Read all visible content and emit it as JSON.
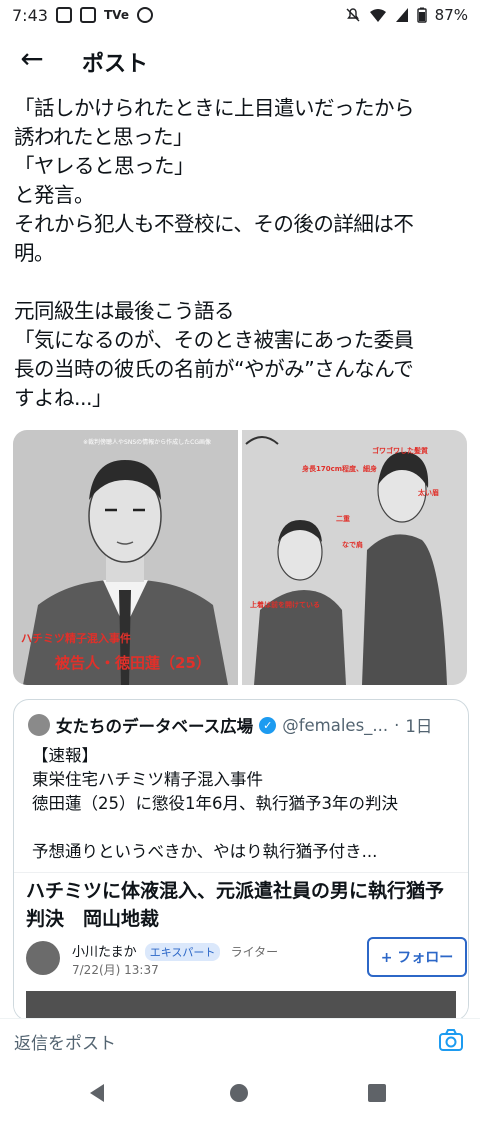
{
  "status_bar": {
    "time": "7:43",
    "left_icons": [
      "calendar-icon",
      "news-icon",
      "tver-icon",
      "lottery-icon"
    ],
    "tver_label": "TVe",
    "battery": "87%",
    "right_icons": [
      "mute-icon",
      "wifi-icon",
      "signal-icon",
      "battery-icon"
    ]
  },
  "header": {
    "back_icon": "arrow-left-icon",
    "title": "ポスト"
  },
  "post": {
    "text": "「話しかけられたときに上目遣いだったから\n誘われたと思った」\n「ヤレると思った」\nと発言。\nそれから犯人も不登校に、その後の詳細は不\n明。\n\n元同級生は最後こう語る\n「気になるのが、そのとき被害にあった委員\n長の当時の彼氏の名前が“やがみ”さんなんで\nすよね...」"
  },
  "images": {
    "left": {
      "caption_top": "※裁判傍聴人やSNSの情報から作成したCG画像",
      "caption_case": "ハチミツ精子混入事件",
      "caption_name": "被告人・徳田蓮（25）"
    },
    "right": {
      "labels": [
        "ゴワゴワした髪質",
        "身長170cm程度、細身",
        "太い眉",
        "二重",
        "なで肩",
        "上着は前を開けている"
      ]
    }
  },
  "quote": {
    "account_name": "女たちのデータベース広場",
    "handle": "@females_...",
    "time": "1日",
    "body": "【速報】\n東栄住宅ハチミツ精子混入事件\n徳田蓮（25）に懲役1年6月、執行猶予3年の判決\n\n予想通りというべきか、やはり執行猶予付き..."
  },
  "article": {
    "title": "ハチミツに体液混入、元派遣社員の男に執行猶予判決　岡山地裁",
    "author": "小川たまか",
    "badge": "エキスパート",
    "role": "ライター",
    "date": "7/22(月) 13:37",
    "follow_label": "+ フォロー"
  },
  "reply_bar": {
    "placeholder": "返信をポスト",
    "camera_icon": "camera-icon"
  },
  "nav": {
    "icons": [
      "nav-back-icon",
      "nav-home-icon",
      "nav-recents-icon"
    ]
  }
}
